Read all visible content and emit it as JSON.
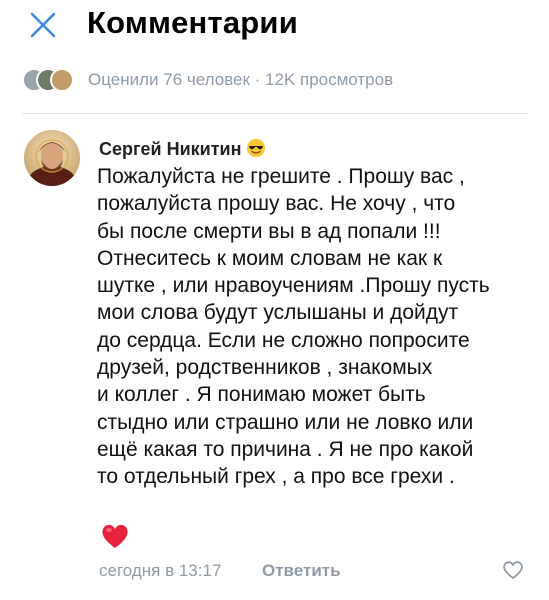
{
  "header": {
    "title": "Комментарии"
  },
  "rated": {
    "text": "Оценили 76 человек · 12K просмотров"
  },
  "comment": {
    "author": "Сергей Никитин",
    "author_emoji": "smiling-face-with-sunglasses",
    "text": "Пожалуйста не грешите . Прошу вас ,\nпожалуйста прошу вас. Не хочу , что\nбы после смерти вы в ад попали !!!\nОтнеситесь к моим словам не как к\nшутке , или нравоучениям .Прошу пусть\nмои слова будут услышаны и дойдут\nдо сердца. Если не сложно попросите\nдрузей, родственников , знакомых\nи коллег . Я понимаю может быть\nстыдно или страшно или не ловко или\nещё какая то причина . Я не про какой\nто отдельный грех , а про все грехи .",
    "reaction_icon": "red-heart-icon",
    "time": "сегодня в 13:17",
    "reply_label": "Ответить"
  },
  "colors": {
    "accent": "#3f8ae0",
    "secondary_text": "#8e9aa8",
    "heart": "#e8233b"
  }
}
